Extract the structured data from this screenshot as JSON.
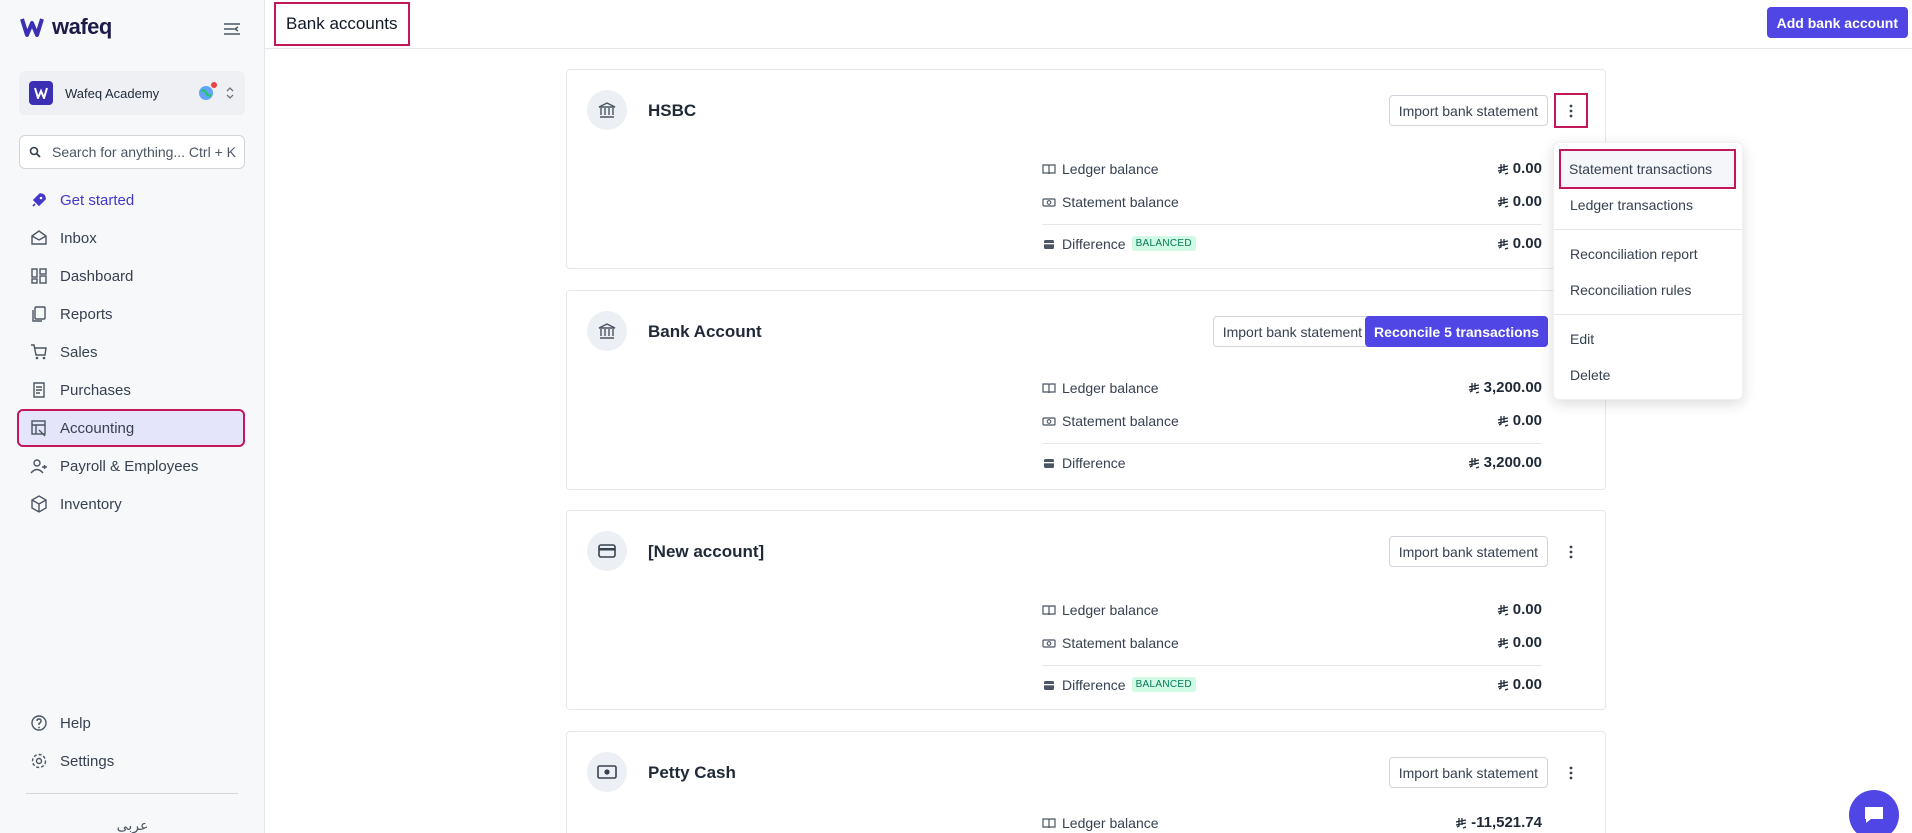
{
  "app": {
    "logo_text": "wafeq"
  },
  "org": {
    "name": "Wafeq Academy"
  },
  "search": {
    "placeholder": "Search for anything...",
    "shortcut": "Ctrl + K"
  },
  "nav": {
    "items": [
      {
        "label": "Get started",
        "icon": "rocket-icon"
      },
      {
        "label": "Inbox",
        "icon": "inbox-icon"
      },
      {
        "label": "Dashboard",
        "icon": "dashboard-icon"
      },
      {
        "label": "Reports",
        "icon": "reports-icon"
      },
      {
        "label": "Sales",
        "icon": "cart-icon"
      },
      {
        "label": "Purchases",
        "icon": "receipt-icon"
      },
      {
        "label": "Accounting",
        "icon": "ledger-icon"
      },
      {
        "label": "Payroll & Employees",
        "icon": "people-icon"
      },
      {
        "label": "Inventory",
        "icon": "box-icon"
      }
    ],
    "bottom": [
      {
        "label": "Help",
        "icon": "help-icon"
      },
      {
        "label": "Settings",
        "icon": "gear-icon"
      }
    ],
    "language": "عربى"
  },
  "header": {
    "title": "Bank accounts",
    "add_button": "Add bank account"
  },
  "labels": {
    "ledger": "Ledger balance",
    "statement": "Statement balance",
    "difference": "Difference",
    "balanced": "BALANCED",
    "import": "Import bank statement"
  },
  "accounts": [
    {
      "name": "HSBC",
      "ledger": "0.00",
      "statement": "0.00",
      "difference": "0.00"
    },
    {
      "name": "Bank Account",
      "reconcile": "Reconcile 5 transactions",
      "ledger": "3,200.00",
      "statement": "0.00",
      "difference": "3,200.00"
    },
    {
      "name": "[New account]",
      "ledger": "0.00",
      "statement": "0.00",
      "difference": "0.00"
    },
    {
      "name": "Petty Cash",
      "ledger": "-11,521.74"
    }
  ],
  "menu": {
    "statement_tx": "Statement transactions",
    "ledger_tx": "Ledger transactions",
    "recon_report": "Reconciliation report",
    "recon_rules": "Reconciliation rules",
    "edit": "Edit",
    "delete": "Delete"
  },
  "colors": {
    "accent": "#4f46e5",
    "highlight": "#c2185b",
    "balanced_bg": "#d1fae5"
  }
}
